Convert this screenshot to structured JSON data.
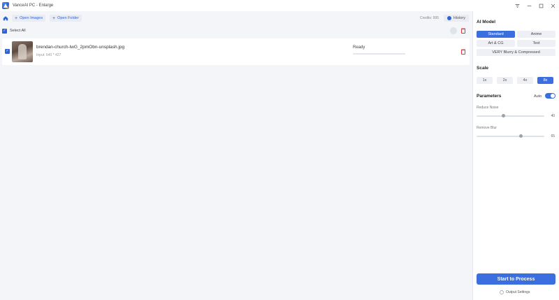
{
  "window": {
    "title": "VanceAI PC - Enlarge",
    "controls": [
      "filter-icon",
      "minimize-icon",
      "maximize-icon",
      "close-icon"
    ]
  },
  "toolbar": {
    "open_images": "Open Images",
    "open_folder": "Open Folder",
    "credits": "Credits: 995",
    "history": "History"
  },
  "selectbar": {
    "select_all": "Select All"
  },
  "files": [
    {
      "name": "brendan-church-lwG_2pmObn-unsplash.jpg",
      "input": "Input: 640 * 427",
      "status": "Ready",
      "progress": 0
    }
  ],
  "panel": {
    "ai_model_title": "AI Model",
    "models": [
      "Standard",
      "Anime",
      "Art & CG",
      "Text",
      "VERY Blurry & Compressed"
    ],
    "selected_model": "Standard",
    "scale_title": "Scale",
    "scales": [
      "1x",
      "2x",
      "4x",
      "8x"
    ],
    "selected_scale": "8x",
    "parameters_title": "Parameters",
    "auto_label": "Auto",
    "auto_on": true,
    "reduce_noise_label": "Reduce Noise",
    "reduce_noise_value": "40",
    "remove_blur_label": "Remove Blur",
    "remove_blur_value": "65",
    "process_label": "Start to Process",
    "output_settings": "Output Settings"
  },
  "colors": {
    "accent": "#3b6fe0",
    "delete": "#e53935"
  }
}
